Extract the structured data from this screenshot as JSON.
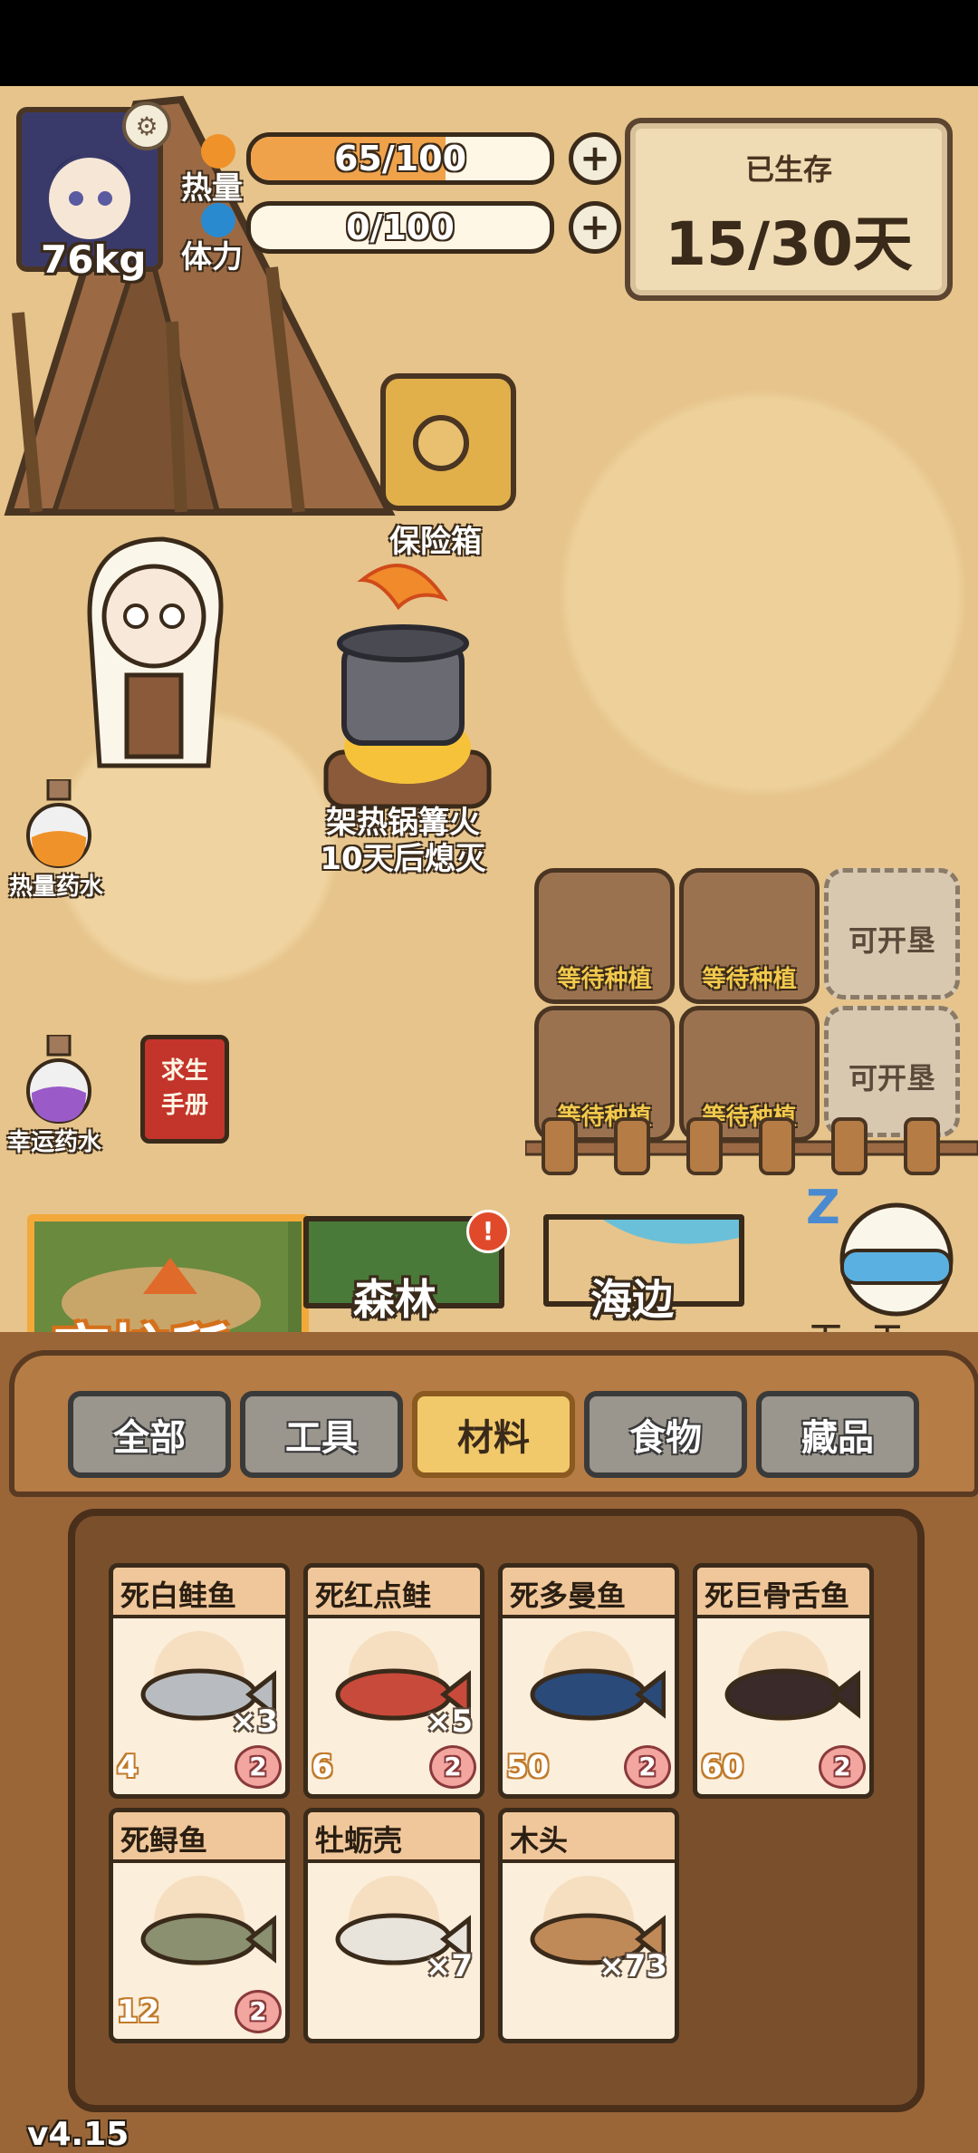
{
  "hud": {
    "weight": "76kg",
    "heat": {
      "label": "热量",
      "value": "65/100",
      "fill": 0.65
    },
    "stamina": {
      "label": "体力",
      "value": "0/100",
      "fill": 0.0
    },
    "days": {
      "title": "已生存",
      "value": "15/30天"
    }
  },
  "scene": {
    "safe_label": "保险箱",
    "campfire_line1": "架热锅篝火",
    "campfire_line2": "10天后熄灭",
    "heat_potion": "热量药水",
    "luck_potion": "幸运药水",
    "manual_line1": "求生",
    "manual_line2": "手册",
    "plots": [
      {
        "label": "等待种植"
      },
      {
        "label": "等待种植"
      },
      {
        "label": "可开垦"
      },
      {
        "label": "等待种植"
      },
      {
        "label": "等待种植"
      },
      {
        "label": "可开垦"
      }
    ]
  },
  "locations": {
    "shelter": "庇护所",
    "forest": "森林",
    "forest_badge": "!",
    "seaside": "海边",
    "next_day": "下一天"
  },
  "tabs": [
    "全部",
    "工具",
    "材料",
    "食物",
    "藏品"
  ],
  "active_tab": "材料",
  "items": [
    {
      "name": "死白鲑鱼",
      "qty": "×3",
      "heat": "4",
      "pig": "2",
      "icon": "whitefish-icon",
      "color": "#b8bcc0"
    },
    {
      "name": "死红点鲑",
      "qty": "×5",
      "heat": "6",
      "pig": "2",
      "icon": "red-trout-icon",
      "color": "#c84a3a"
    },
    {
      "name": "死多曼鱼",
      "qty": "",
      "heat": "50",
      "pig": "2",
      "icon": "dolly-varden-icon",
      "color": "#2a4a7a"
    },
    {
      "name": "死巨骨舌鱼",
      "qty": "",
      "heat": "60",
      "pig": "2",
      "icon": "arapaima-icon",
      "color": "#3a2a2a"
    },
    {
      "name": "死鲟鱼",
      "qty": "",
      "heat": "12",
      "pig": "2",
      "icon": "sturgeon-icon",
      "color": "#8a9070"
    },
    {
      "name": "牡蛎壳",
      "qty": "×7",
      "heat": "",
      "pig": "",
      "icon": "oyster-shell-icon",
      "color": "#e8e4dc"
    },
    {
      "name": "木头",
      "qty": "×73",
      "heat": "",
      "pig": "",
      "icon": "wood-log-icon",
      "color": "#c08a58"
    }
  ],
  "version": "v4.15"
}
